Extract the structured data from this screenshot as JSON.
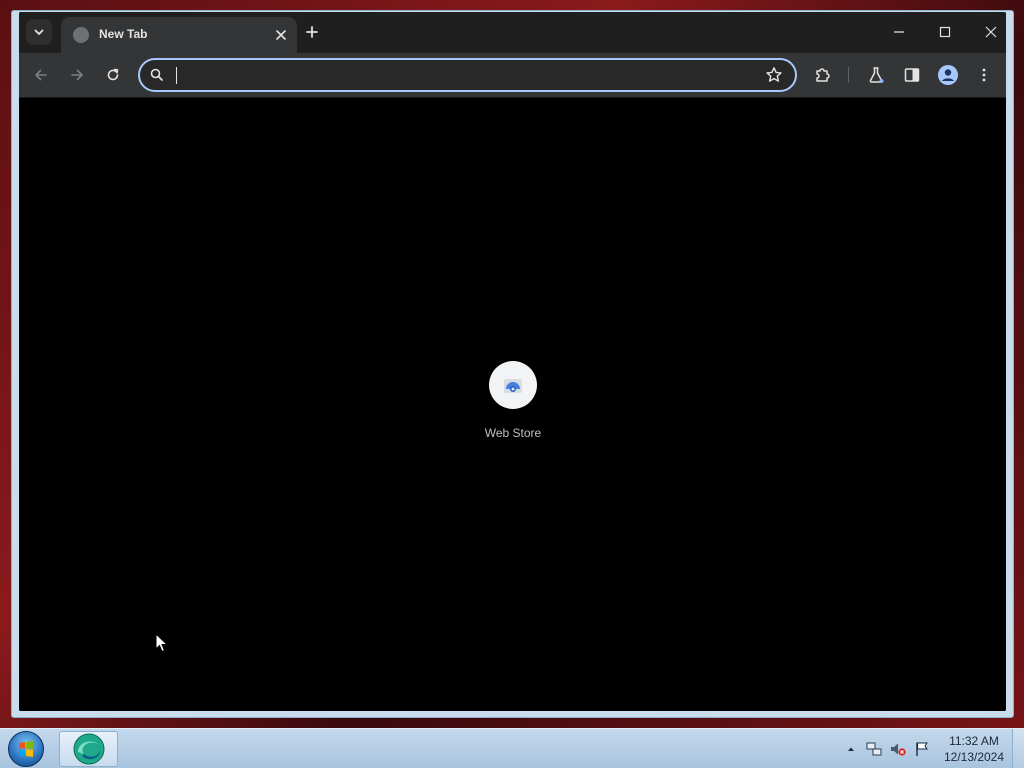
{
  "browser": {
    "tab": {
      "title": "New Tab",
      "favicon": "globe-icon"
    },
    "window_controls": [
      "minimize-icon",
      "maximize-icon",
      "close-icon"
    ],
    "toolbar": {
      "buttons": [
        "back-icon",
        "forward-icon",
        "reload-icon",
        "extensions-icon",
        "labs-icon",
        "side-panel-icon",
        "profile-icon",
        "menu-icon"
      ]
    },
    "omnibox": {
      "value": "",
      "placeholder": ""
    },
    "accent_color": "#a8c7fa"
  },
  "ntp": {
    "shortcuts": [
      {
        "label": "Web Store",
        "icon": "web-store-icon"
      }
    ]
  },
  "taskbar": {
    "clock": {
      "time": "11:32 AM",
      "date": "12/13/2024"
    },
    "tray": [
      "show-hidden-icons",
      "network-icon",
      "volume-muted-icon",
      "action-center-flag-icon"
    ]
  }
}
